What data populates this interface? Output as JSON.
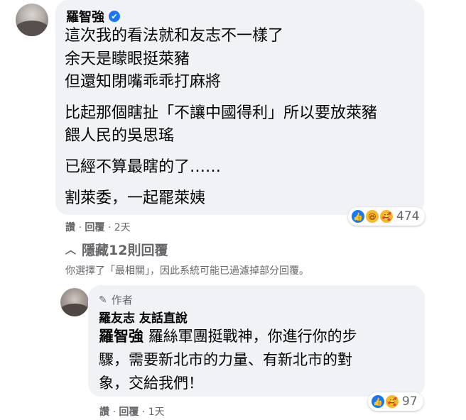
{
  "comment": {
    "author": "羅智強",
    "verified_icon": "✔",
    "lines": [
      "這次我的看法就和友志不一樣了",
      "余天是矇眼挺萊豬",
      "但還知閉嘴乖乖打麻將",
      "比起那個瞎扯「不讓中國得利」所以要放萊豬",
      "餵人民的吳思瑤",
      "已經不算最瞎的了……",
      "割萊委，一起罷萊姨"
    ],
    "reactions": {
      "icons": [
        "like-icon",
        "haha-icon",
        "care-icon"
      ],
      "count": "474"
    },
    "meta": {
      "like": "讚",
      "sep": "·",
      "reply": "回覆",
      "time": "2天"
    }
  },
  "replies_toggle": {
    "label": "隱藏12則回覆",
    "icon": "chevron-up-icon"
  },
  "filter_notice": "你選擇了「最相關」，因此系統可能已過濾掉部分回覆。",
  "reply": {
    "badge": "作者",
    "badge_icon": "pencil-icon",
    "author": "羅友志 友話直說",
    "mention": "羅智強",
    "lines": [
      "羅絲軍團挺戰神，你進行你的步",
      "驟，需要新北市的力量、有新北市的對",
      "象，交給我們！"
    ],
    "reactions": {
      "icons": [
        "like-icon",
        "care-icon"
      ],
      "count": "97"
    },
    "meta": {
      "like": "讚",
      "sep": "·",
      "reply": "回覆",
      "time": "1天"
    }
  },
  "colors": {
    "bubble": "#f0f2f5",
    "secondary_text": "#65676b",
    "primary_text": "#050505",
    "like_blue": "#1877f2",
    "emoji_yellow": "#f7b928"
  }
}
